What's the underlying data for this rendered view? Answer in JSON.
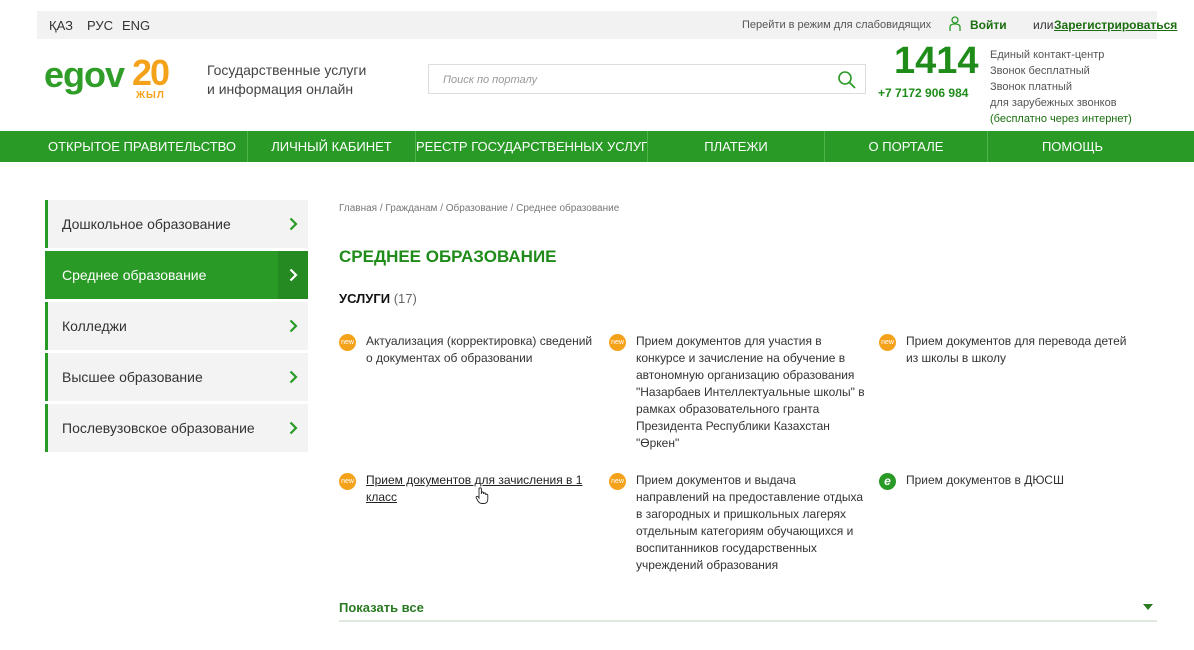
{
  "topbar": {
    "languages": [
      "ҚАЗ",
      "РУС",
      "ENG"
    ],
    "accessibility_label": "Перейти в режим для слабовидящих",
    "login_label": "Войти",
    "or_label": "или",
    "register_label": "Зарегистрироваться"
  },
  "header": {
    "logo_text": "egov",
    "logo_number": "20",
    "logo_year": "ЖЫЛ",
    "tagline_line1": "Государственные услуги",
    "tagline_line2": "и информация онлайн",
    "search_placeholder": "Поиск по порталу",
    "hotline_number": "1414",
    "phone_number": "+7 7172 906 984",
    "contact_line1": "Единый контакт-центр",
    "contact_line2": "Звонок бесплатный",
    "contact_line3": "Звонок платный",
    "contact_line4": "для зарубежных звонков",
    "contact_line5": "(бесплатно через интернет)"
  },
  "nav": {
    "items": [
      "ОТКРЫТОЕ ПРАВИТЕЛЬСТВО",
      "ЛИЧНЫЙ КАБИНЕТ",
      "РЕЕСТР ГОСУДАРСТВЕННЫХ УСЛУГ",
      "ПЛАТЕЖИ",
      "О ПОРТАЛЕ",
      "ПОМОЩЬ"
    ]
  },
  "sidebar": {
    "items": [
      {
        "label": "Дошкольное образование",
        "active": false
      },
      {
        "label": "Среднее образование",
        "active": true
      },
      {
        "label": "Колледжи",
        "active": false
      },
      {
        "label": "Высшее образование",
        "active": false
      },
      {
        "label": "Послевузовское образование",
        "active": false
      }
    ]
  },
  "main": {
    "breadcrumb": [
      "Главная",
      "Гражданам",
      "Образование",
      "Среднее образование"
    ],
    "breadcrumb_separator": " / ",
    "title": "СРЕДНЕЕ ОБРАЗОВАНИЕ",
    "section_label": "УСЛУГИ",
    "section_count": "(17)",
    "services": [
      {
        "badge": "new",
        "text": "Актуализация (корректировка) сведений о документах об образовании"
      },
      {
        "badge": "new",
        "text": "Прием документов для участия в конкурсе и зачисление на обучение в автономную организацию образования \"Назарбаев Интеллектуальные школы\" в рамках образовательного гранта Президента Республики Казахстан \"Өркен\""
      },
      {
        "badge": "new",
        "text": "Прием документов для перевода детей из школы в школу"
      },
      {
        "badge": "new",
        "text": "Прием документов для зачисления в 1 класс"
      },
      {
        "badge": "new",
        "text": "Прием документов и выдача направлений на предоставление отдыха в загородных и пришкольных лагерях отдельным категориям обучающихся и воспитанников государственных учреждений образования"
      },
      {
        "badge": "e",
        "text": "Прием документов в ДЮСШ"
      }
    ],
    "show_all_label": "Показать все"
  },
  "colors": {
    "brand_green": "#2a9a27",
    "dark_green": "#1f8c1a",
    "accent_orange": "#f5a21b",
    "topbar_bg": "#f2f2f2"
  }
}
